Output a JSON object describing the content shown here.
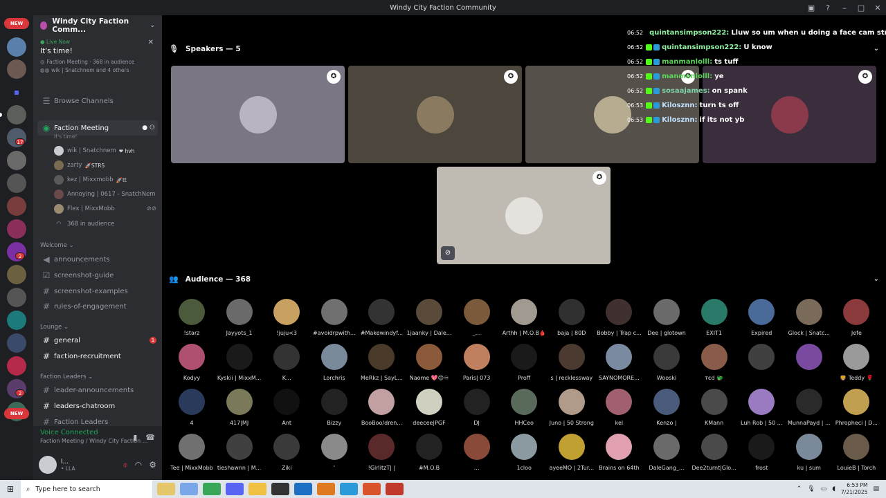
{
  "window": {
    "title": "Windy City Faction Community"
  },
  "guilds": {
    "new_label": "NEW",
    "badge_17": "17",
    "badge_2a": "2",
    "badge_2b": "2"
  },
  "server": {
    "name": "Windy City Faction Comm..."
  },
  "live": {
    "label": "Live Now",
    "title": "It's time!",
    "meta": "Faction Meeting · 368 in audience",
    "speakers": "wik | Snatchnem and 4 others"
  },
  "sidebar": {
    "browse": "Browse Channels",
    "stage_name": "Faction Meeting",
    "stage_topic": "It's time!",
    "members": [
      {
        "name": "wik | Snatchnem",
        "tag": "❤ hvh"
      },
      {
        "name": "zarty",
        "tag": "🚀STRS"
      },
      {
        "name": "kez | Mixxmobb",
        "tag": "🚀tt"
      },
      {
        "name": "Annoying | 0617 - SnatchNem",
        "tag": ""
      },
      {
        "name": "Flex | MixxMobb",
        "tag": ""
      }
    ],
    "audience_count": "368 in audience",
    "cat_welcome": "Welcome",
    "welcome_channels": [
      "announcements",
      "screenshot-guide",
      "screenshot-examples",
      "rules-of-engagement"
    ],
    "cat_lounge": "Lounge",
    "lounge_channels": [
      "general",
      "faction-recruitment"
    ],
    "unread_general": "1",
    "cat_leaders": "Faction Leaders",
    "leader_channels": [
      "leader-announcements",
      "leaders-chatroom",
      "Faction Leaders"
    ]
  },
  "voice": {
    "status": "Voice Connected",
    "location": "Faction Meeting / Windy City Faction ..."
  },
  "user": {
    "name": "l...",
    "status": "• LLA"
  },
  "speakers": {
    "header": "Speakers — 5"
  },
  "audience": {
    "header": "Audience — 368",
    "members": [
      "!starz",
      "Jayyots_1",
      "!juju<3",
      "#avoidrpwith...",
      "#Makewindyf...",
      "1jaanky | Dale...",
      "_...",
      "Arthh | M.O.B🩸",
      "baja | 80D",
      "Bobby | Trap c...",
      "Dee | glotown",
      "EXIT1",
      "Expired",
      "Glock | Snatc...",
      "Jefe",
      "Kodyy",
      "Kyskii | MixxM...",
      "K...",
      "Lorchris",
      "MeRkz | SayL...",
      "Naome 💖😊♾",
      "Paris| 073",
      "Proff",
      "s | recklessway",
      "SAYNOMORE...",
      "Wooski",
      "тєd 🐲",
      "",
      "",
      "🦁 Teddy 🌹",
      "4",
      "417|MJ",
      "Ant",
      "Bizzy",
      "BooBoo/dren...",
      "deecee|PGF",
      "DJ",
      "HHCeo",
      "Juno | 50 Strong",
      "kel",
      "Kenzo |",
      "KMann",
      "Luh Rob | 50 ...",
      "MunnaPayd | ...",
      "Phropheci | D...",
      "Tee | MixxMobb",
      "tieshawnn | M...",
      "Ziki",
      "'",
      "!GirlitzT| |",
      "#M.O.B",
      "...",
      "1cloo",
      "ayeeMO | 2Tur...",
      "Brains on 64th",
      "DaleGang_...",
      "Dee2turnt|Glo...",
      "frost",
      "ku | sum",
      "LouieB | Torch"
    ]
  },
  "chat": [
    {
      "time": "06:52",
      "user": "quintansimpson222:",
      "text": "Lluw so um when u doing a face cam strea",
      "color": "#8ef0a0"
    },
    {
      "time": "06:52",
      "user": "quintansimpson222:",
      "text": "U know",
      "color": "#8ef0a0"
    },
    {
      "time": "06:52",
      "user": "manmanlolll:",
      "text": "ts tuff",
      "color": "#5cd65c"
    },
    {
      "time": "06:52",
      "user": "manmanlolll:",
      "text": "ye",
      "color": "#5cd65c"
    },
    {
      "time": "06:52",
      "user": "sosaajames:",
      "text": "on spank",
      "color": "#7fd3a8"
    },
    {
      "time": "06:53",
      "user": "Kilosznn:",
      "text": "turn ts off",
      "color": "#bfe0ff"
    },
    {
      "time": "06:53",
      "user": "Kilosznn:",
      "text": "if its not yb",
      "color": "#bfe0ff"
    }
  ],
  "taskbar": {
    "search_placeholder": "Type here to search",
    "time": "6:53 PM",
    "date": "7/21/2025"
  }
}
